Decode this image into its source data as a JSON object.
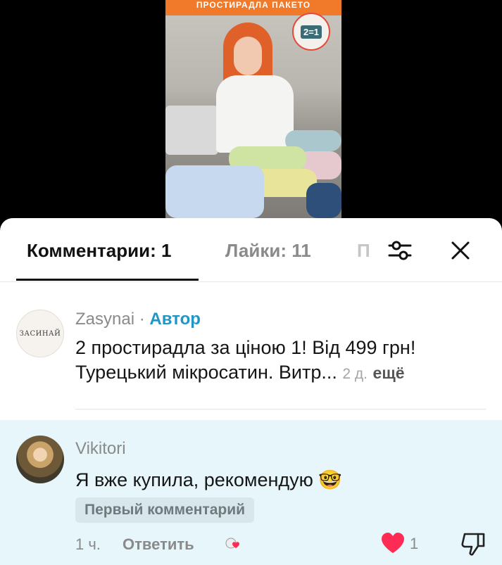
{
  "video": {
    "banner_text": "ПРОСТИРАДЛА ПАКЕТО",
    "badge_text": "2=1"
  },
  "tabs": {
    "comments_label": "Комментарии: 1",
    "likes_label": "Лайки: 11",
    "third_label_partial": "П"
  },
  "icons": {
    "filter": "sliders-icon",
    "close": "close-icon",
    "like": "heart-icon",
    "dislike": "thumbs-down-icon"
  },
  "colors": {
    "accent": "#2196c4",
    "like_heart": "#fe2c55",
    "highlight_bg": "#e6f6fa"
  },
  "comments": [
    {
      "avatar_text": "ЗАСИНАЙ",
      "username": "Zasynai",
      "separator": " · ",
      "role_badge": "Автор",
      "text_line1": "2 простирадла за ціною 1! Від 499 грн!",
      "text_line2": "Турецький мікросатин. Витр...",
      "time": "2 д.",
      "more_label": "ещё"
    },
    {
      "username": "Vikitori",
      "text": "Я вже купила, рекомендую 🤓",
      "first_badge": "Первый комментарий",
      "time": "1 ч.",
      "reply_label": "Ответить",
      "like_count": "1"
    }
  ]
}
